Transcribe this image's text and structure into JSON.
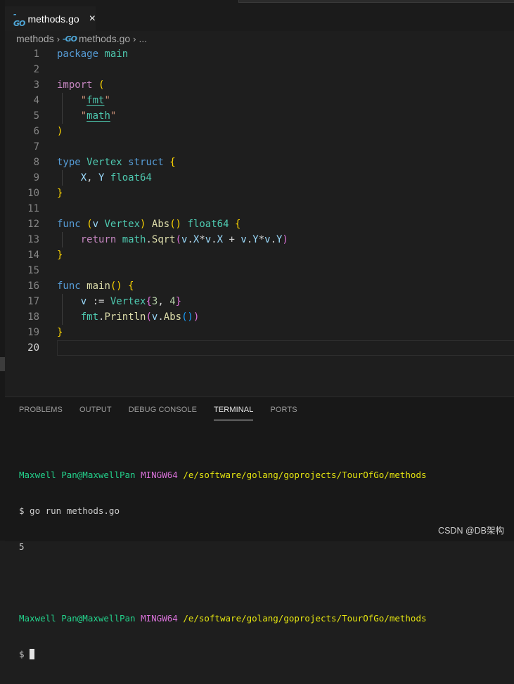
{
  "tab": {
    "icon": "go-file-icon",
    "label": "methods.go",
    "close": "×"
  },
  "breadcrumb": {
    "folder": "methods",
    "file": "methods.go",
    "more": "..."
  },
  "editor": {
    "lines": [
      "1",
      "2",
      "3",
      "4",
      "5",
      "6",
      "7",
      "8",
      "9",
      "10",
      "11",
      "12",
      "13",
      "14",
      "15",
      "16",
      "17",
      "18",
      "19",
      "20"
    ],
    "active_line": "20"
  },
  "panel": {
    "tabs": [
      "PROBLEMS",
      "OUTPUT",
      "DEBUG CONSOLE",
      "TERMINAL",
      "PORTS"
    ],
    "active_tab": "TERMINAL"
  },
  "terminal": {
    "prompt1": {
      "user": "Maxwell Pan@MaxwellPan",
      "shell": "MINGW64",
      "path": "/e/software/golang/goprojects/TourOfGo/methods"
    },
    "command": "$ go run methods.go",
    "output": "5",
    "prompt2": {
      "user": "Maxwell Pan@MaxwellPan",
      "shell": "MINGW64",
      "path": "/e/software/golang/goprojects/TourOfGo/methods"
    },
    "input_prompt": "$ "
  },
  "watermark": "CSDN @DB架构",
  "colors": {
    "keyword": "#569cd6",
    "control": "#c586c0",
    "type": "#4ec9b0",
    "function": "#dcdcaa",
    "variable": "#9cdcfe",
    "string": "#ce9178",
    "number": "#b5cea8"
  }
}
